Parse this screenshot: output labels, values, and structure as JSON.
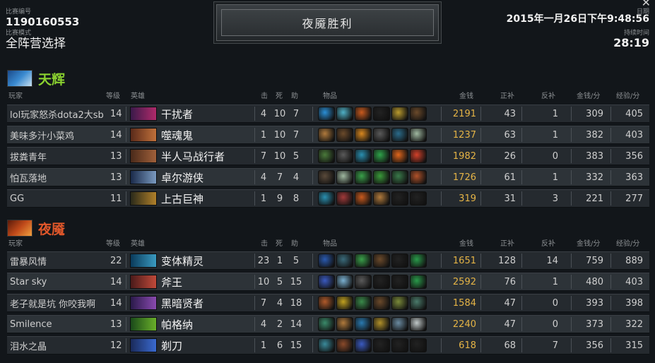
{
  "match": {
    "id_label": "比赛编号",
    "id": "1190160553",
    "mode_label": "比赛模式",
    "mode": "全阵营选择",
    "result": "夜魇胜利",
    "date_label": "日期",
    "date": "2015年一月26日下午9:48:56",
    "duration_label": "持续时间",
    "duration": "28:19"
  },
  "columns": {
    "player": "玩家",
    "level": "等级",
    "hero": "英雄",
    "kills": "击",
    "deaths": "死",
    "assists": "助",
    "items": "物品",
    "gold": "金钱",
    "last_hits": "正补",
    "denies": "反补",
    "gpm": "金钱/分",
    "xpm": "经验/分"
  },
  "colors": {
    "radiant": "#8ad12f",
    "dire": "#e0572a",
    "gold": "#e5b446"
  },
  "radiant": {
    "name": "天辉",
    "players": [
      {
        "player": "lol玩家怒杀dota2大sb",
        "level": "14",
        "hero": "干扰者",
        "k": "4",
        "d": "10",
        "a": "7",
        "gold": "2191",
        "lh": "43",
        "dn": "1",
        "gpm": "309",
        "xpm": "405",
        "items": [
          "#2a8fd6",
          "#4fb0c6",
          "#c85a1e",
          "#222222",
          "#b99a2e",
          "#6b4a2b"
        ]
      },
      {
        "player": "美味多汁小菜鸡",
        "level": "14",
        "hero": "噬魂鬼",
        "k": "1",
        "d": "10",
        "a": "7",
        "gold": "1237",
        "lh": "63",
        "dn": "1",
        "gpm": "382",
        "xpm": "403",
        "items": [
          "#b07a3c",
          "#6b4a2b",
          "#d8871f",
          "#5a5a5a",
          "#2b6b8a",
          "#9fb8a0"
        ]
      },
      {
        "player": "拔粪青年",
        "level": "13",
        "hero": "半人马战行者",
        "k": "7",
        "d": "10",
        "a": "5",
        "gold": "1982",
        "lh": "26",
        "dn": "0",
        "gpm": "383",
        "xpm": "356",
        "items": [
          "#4a7a3a",
          "#5a5a5a",
          "#2a8fb0",
          "#2fa34a",
          "#e0661c",
          "#d2412a"
        ]
      },
      {
        "player": "怕瓦落地",
        "level": "13",
        "hero": "卓尔游侠",
        "k": "4",
        "d": "7",
        "a": "4",
        "gold": "1726",
        "lh": "61",
        "dn": "1",
        "gpm": "332",
        "xpm": "363",
        "items": [
          "#5a4a3a",
          "#9fb8a0",
          "#3aa04a",
          "#3a9a3a",
          "#3a7a4a",
          "#b0522a"
        ]
      },
      {
        "player": "GG",
        "level": "11",
        "hero": "上古巨神",
        "k": "1",
        "d": "9",
        "a": "8",
        "gold": "319",
        "lh": "31",
        "dn": "3",
        "gpm": "221",
        "xpm": "277",
        "items": [
          "#2a8fb0",
          "#a03a3a",
          "#c85a1e",
          "#b07a3c",
          "#222222",
          "#222222"
        ]
      }
    ]
  },
  "dire": {
    "name": "夜魇",
    "players": [
      {
        "player": "雷暴风情",
        "level": "22",
        "hero": "变体精灵",
        "k": "23",
        "d": "1",
        "a": "5",
        "gold": "1651",
        "lh": "128",
        "dn": "14",
        "gpm": "759",
        "xpm": "889",
        "items": [
          "#2a5ab0",
          "#3a6a7a",
          "#3aa04a",
          "#6b4a2b",
          "#222222",
          "#2a9a4a"
        ]
      },
      {
        "player": "Star sky",
        "level": "14",
        "hero": "斧王",
        "k": "10",
        "d": "5",
        "a": "15",
        "gold": "2592",
        "lh": "76",
        "dn": "1",
        "gpm": "480",
        "xpm": "403",
        "items": [
          "#3a5ac0",
          "#7ab0d0",
          "#5a5a5a",
          "#222222",
          "#222222",
          "#2a9a4a"
        ]
      },
      {
        "player": "老子就是坑 你咬我啊",
        "level": "14",
        "hero": "黑暗贤者",
        "k": "7",
        "d": "4",
        "a": "18",
        "gold": "1584",
        "lh": "47",
        "dn": "0",
        "gpm": "393",
        "xpm": "398",
        "items": [
          "#b05a2a",
          "#c0a020",
          "#3a8a4a",
          "#6b4a2b",
          "#7a8a3a",
          "#4a7a6a"
        ]
      },
      {
        "player": "Smilence",
        "level": "13",
        "hero": "帕格纳",
        "k": "4",
        "d": "2",
        "a": "14",
        "gold": "2240",
        "lh": "47",
        "dn": "0",
        "gpm": "373",
        "xpm": "322",
        "items": [
          "#3a8a6a",
          "#b07a3c",
          "#2a7ab0",
          "#b0902a",
          "#6a8aa0",
          "#c0c8c8"
        ]
      },
      {
        "player": "泪水之晶",
        "level": "12",
        "hero": "剃刀",
        "k": "1",
        "d": "6",
        "a": "15",
        "gold": "618",
        "lh": "68",
        "dn": "7",
        "gpm": "356",
        "xpm": "315",
        "items": [
          "#3a8a9a",
          "#8a4a2a",
          "#3a5ac0",
          "#222222",
          "#222222",
          "#222222"
        ]
      }
    ]
  }
}
